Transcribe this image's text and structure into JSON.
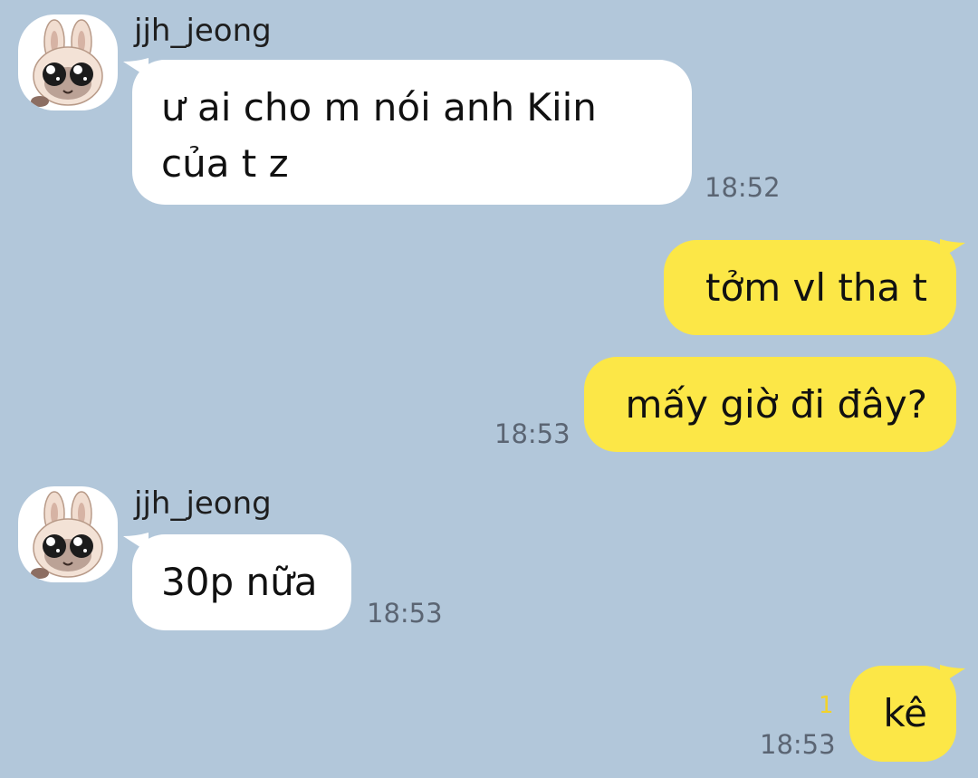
{
  "chat": {
    "messages": [
      {
        "sender": "jjh_jeong",
        "text_line1": "ư ai cho m nói anh Kiin",
        "text_line2": "của t z",
        "time": "18:52"
      },
      {
        "text": "tởm vl tha t"
      },
      {
        "text": "mấy giờ đi đây?",
        "time": "18:53"
      },
      {
        "sender": "jjh_jeong",
        "text": "30p nữa",
        "time": "18:53"
      },
      {
        "text": "kê",
        "time": "18:53",
        "unread": "1"
      }
    ]
  },
  "colors": {
    "background": "#b2c7da",
    "incoming_bubble": "#ffffff",
    "outgoing_bubble": "#fce747",
    "unread_count": "#f2d22a"
  },
  "icons": {
    "avatar": "cat-sticker-avatar-icon"
  }
}
